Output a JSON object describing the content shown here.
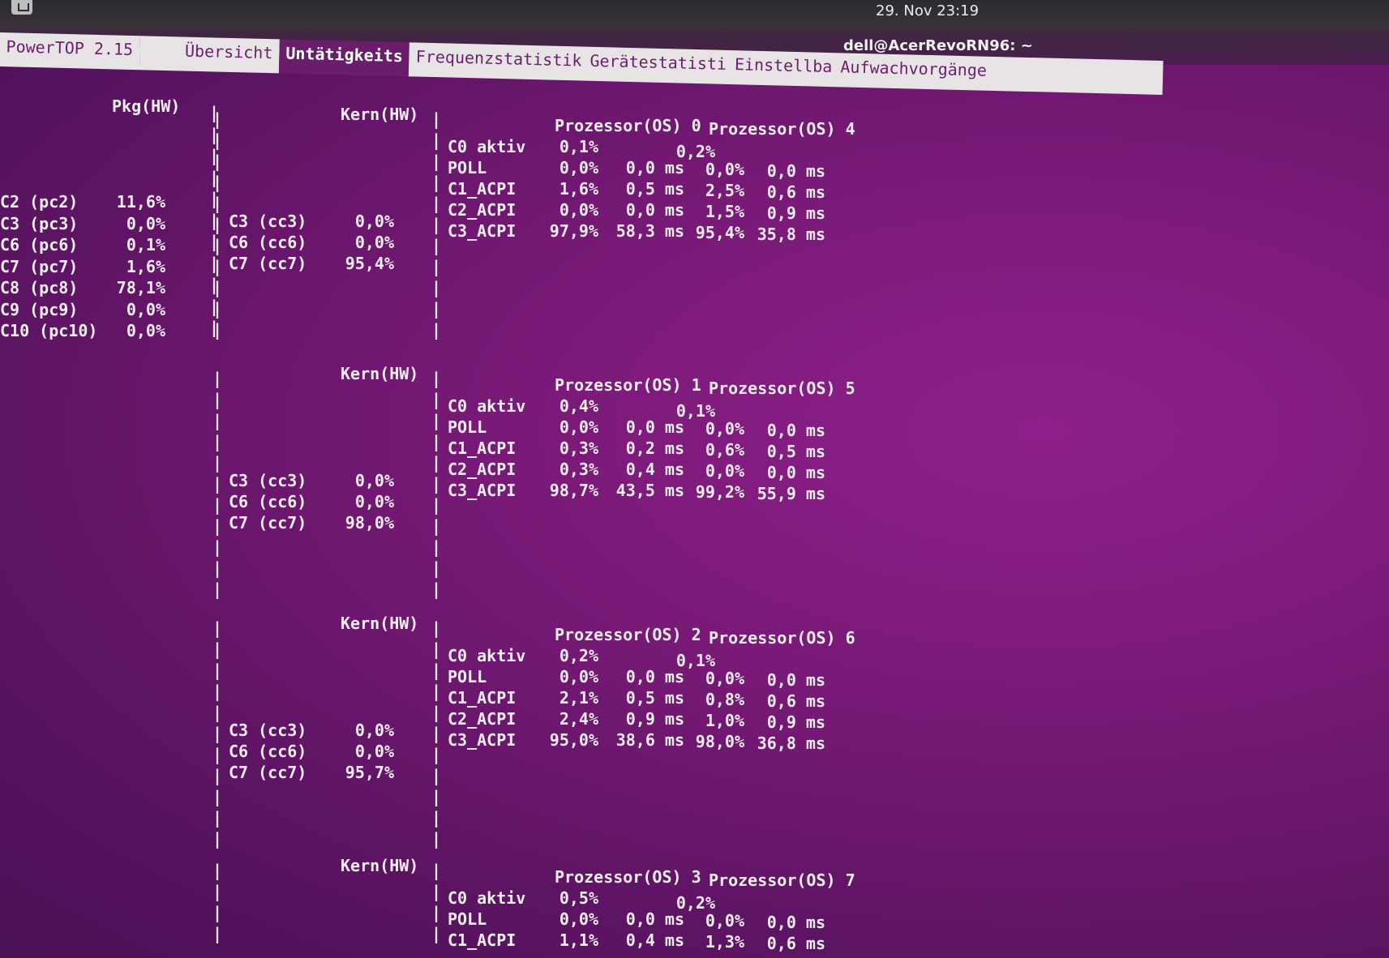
{
  "topbar": {
    "clock": "29. Nov  23:19"
  },
  "window": {
    "title": "dell@AcerRevoRN96: ~"
  },
  "tabs": {
    "app": "PowerTOP 2.15",
    "overview": "Übersicht",
    "idle": "Untätigkeits",
    "freq": "Frequenzstatistik",
    "devices": "Gerätestatisti",
    "tunables": "Einstellba",
    "wakeup": "Aufwachvorgänge"
  },
  "pkg": {
    "header": "Pkg(HW)",
    "rows": [
      {
        "state": "C2 (pc2)",
        "value": "11,6%"
      },
      {
        "state": "C3 (pc3)",
        "value": "0,0%"
      },
      {
        "state": "C6 (pc6)",
        "value": "0,1%"
      },
      {
        "state": "C7 (pc7)",
        "value": "1,6%"
      },
      {
        "state": "C8 (pc8)",
        "value": "78,1%"
      },
      {
        "state": "C9 (pc9)",
        "value": "0,0%"
      },
      {
        "state": "C10 (pc10)",
        "value": "0,0%"
      }
    ]
  },
  "cores": [
    {
      "header": "Kern(HW)",
      "cstates": [
        {
          "state": "C3 (cc3)",
          "value": "0,0%"
        },
        {
          "state": "C6 (cc6)",
          "value": "0,0%"
        },
        {
          "state": "C7 (cc7)",
          "value": "95,4%"
        }
      ],
      "proc_header_a": "Prozessor(OS) 0",
      "proc_header_b": "Prozessor(OS) 4",
      "rows": [
        {
          "state": "C0 aktiv",
          "a_pct": "0,1%",
          "a_ms": "",
          "b_pct": "0,2%",
          "b_ms": ""
        },
        {
          "state": "POLL",
          "a_pct": "0,0%",
          "a_ms": "0,0 ms",
          "b_pct": "0,0%",
          "b_ms": "0,0 ms"
        },
        {
          "state": "C1_ACPI",
          "a_pct": "1,6%",
          "a_ms": "0,5 ms",
          "b_pct": "2,5%",
          "b_ms": "0,6 ms"
        },
        {
          "state": "C2_ACPI",
          "a_pct": "0,0%",
          "a_ms": "0,0 ms",
          "b_pct": "1,5%",
          "b_ms": "0,9 ms"
        },
        {
          "state": "C3_ACPI",
          "a_pct": "97,9%",
          "a_ms": "58,3 ms",
          "b_pct": "95,4%",
          "b_ms": "35,8 ms"
        }
      ]
    },
    {
      "header": "Kern(HW)",
      "cstates": [
        {
          "state": "C3 (cc3)",
          "value": "0,0%"
        },
        {
          "state": "C6 (cc6)",
          "value": "0,0%"
        },
        {
          "state": "C7 (cc7)",
          "value": "98,0%"
        }
      ],
      "proc_header_a": "Prozessor(OS) 1",
      "proc_header_b": "Prozessor(OS) 5",
      "rows": [
        {
          "state": "C0 aktiv",
          "a_pct": "0,4%",
          "a_ms": "",
          "b_pct": "0,1%",
          "b_ms": ""
        },
        {
          "state": "POLL",
          "a_pct": "0,0%",
          "a_ms": "0,0 ms",
          "b_pct": "0,0%",
          "b_ms": "0,0 ms"
        },
        {
          "state": "C1_ACPI",
          "a_pct": "0,3%",
          "a_ms": "0,2 ms",
          "b_pct": "0,6%",
          "b_ms": "0,5 ms"
        },
        {
          "state": "C2_ACPI",
          "a_pct": "0,3%",
          "a_ms": "0,4 ms",
          "b_pct": "0,0%",
          "b_ms": "0,0 ms"
        },
        {
          "state": "C3_ACPI",
          "a_pct": "98,7%",
          "a_ms": "43,5 ms",
          "b_pct": "99,2%",
          "b_ms": "55,9 ms"
        }
      ]
    },
    {
      "header": "Kern(HW)",
      "cstates": [
        {
          "state": "C3 (cc3)",
          "value": "0,0%"
        },
        {
          "state": "C6 (cc6)",
          "value": "0,0%"
        },
        {
          "state": "C7 (cc7)",
          "value": "95,7%"
        }
      ],
      "proc_header_a": "Prozessor(OS) 2",
      "proc_header_b": "Prozessor(OS) 6",
      "rows": [
        {
          "state": "C0 aktiv",
          "a_pct": "0,2%",
          "a_ms": "",
          "b_pct": "0,1%",
          "b_ms": ""
        },
        {
          "state": "POLL",
          "a_pct": "0,0%",
          "a_ms": "0,0 ms",
          "b_pct": "0,0%",
          "b_ms": "0,0 ms"
        },
        {
          "state": "C1_ACPI",
          "a_pct": "2,1%",
          "a_ms": "0,5 ms",
          "b_pct": "0,8%",
          "b_ms": "0,6 ms"
        },
        {
          "state": "C2_ACPI",
          "a_pct": "2,4%",
          "a_ms": "0,9 ms",
          "b_pct": "1,0%",
          "b_ms": "0,9 ms"
        },
        {
          "state": "C3_ACPI",
          "a_pct": "95,0%",
          "a_ms": "38,6 ms",
          "b_pct": "98,0%",
          "b_ms": "36,8 ms"
        }
      ]
    },
    {
      "header": "Kern(HW)",
      "cstates": [],
      "proc_header_a": "Prozessor(OS) 3",
      "proc_header_b": "Prozessor(OS) 7",
      "rows": [
        {
          "state": "C0 aktiv",
          "a_pct": "0,5%",
          "a_ms": "",
          "b_pct": "0,2%",
          "b_ms": ""
        },
        {
          "state": "POLL",
          "a_pct": "0,0%",
          "a_ms": "0,0 ms",
          "b_pct": "0,0%",
          "b_ms": "0,0 ms"
        },
        {
          "state": "C1_ACPI",
          "a_pct": "1,1%",
          "a_ms": "0,4 ms",
          "b_pct": "1,3%",
          "b_ms": "0,6 ms"
        }
      ]
    }
  ]
}
